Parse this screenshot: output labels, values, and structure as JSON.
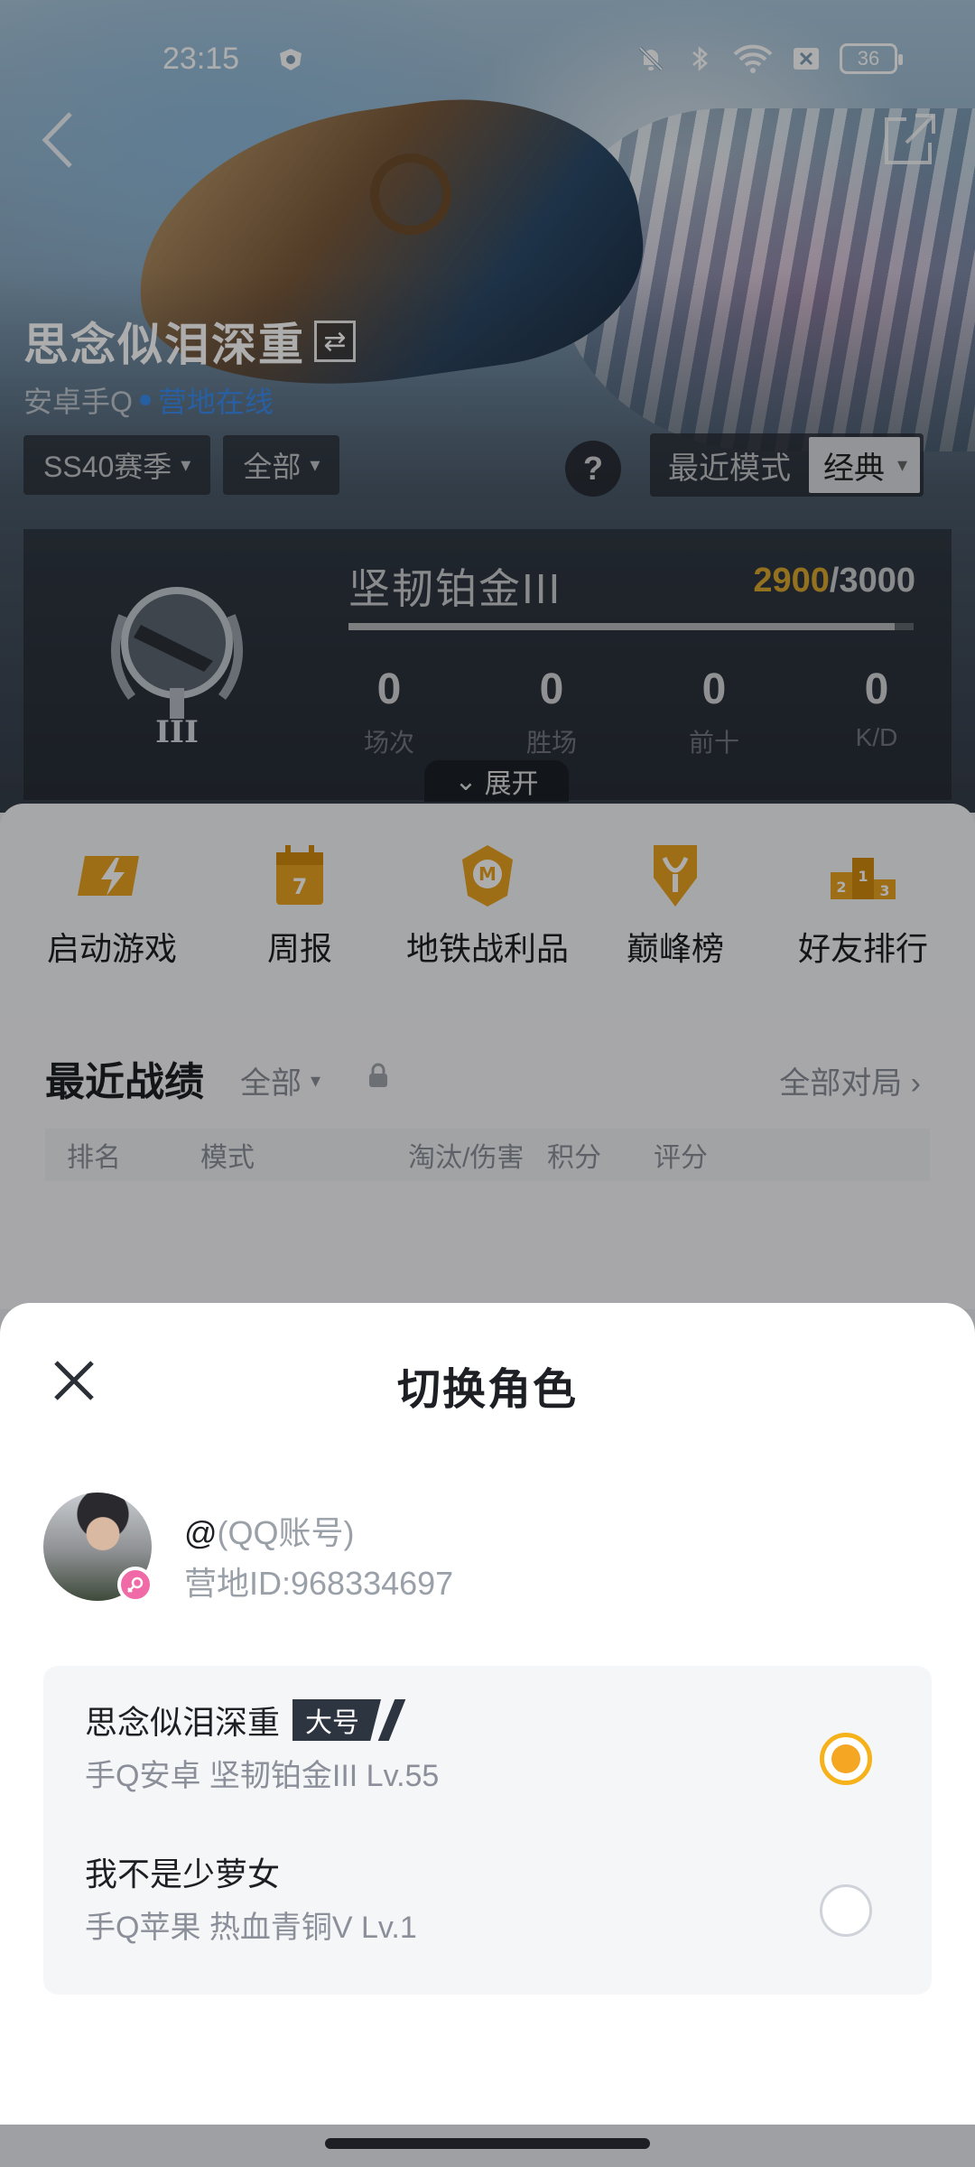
{
  "status_bar": {
    "time": "23:15",
    "battery": "36",
    "icons": [
      "mute-icon",
      "bluetooth-icon",
      "wifi-icon",
      "sim-blocked-icon",
      "battery-icon"
    ]
  },
  "profile": {
    "name": "思念似泪深重",
    "platform": "安卓手Q",
    "online_status": "营地在线"
  },
  "filters": {
    "season": "SS40赛季",
    "scope": "全部",
    "recent_mode_label": "最近模式",
    "mode": "经典",
    "help": "?"
  },
  "rank": {
    "name": "坚韧铂金III",
    "current_points": "2900",
    "max_points": "/3000",
    "progress": 0.967,
    "emblem_tier": "III",
    "stats": [
      {
        "value": "0",
        "label": "场次"
      },
      {
        "value": "0",
        "label": "胜场"
      },
      {
        "value": "0",
        "label": "前十"
      },
      {
        "value": "0",
        "label": "K/D"
      }
    ],
    "expand": "展开"
  },
  "actions": [
    {
      "label": "启动游戏",
      "icon": "lightning-icon"
    },
    {
      "label": "周报",
      "icon": "calendar-icon"
    },
    {
      "label": "地铁战利品",
      "icon": "metro-emblem-icon"
    },
    {
      "label": "巅峰榜",
      "icon": "trophy-icon"
    },
    {
      "label": "好友排行",
      "icon": "podium-icon"
    }
  ],
  "recent": {
    "title": "最近战绩",
    "filter": "全部",
    "all_games": "全部对局",
    "columns": [
      "排名",
      "模式",
      "淘汰/伤害",
      "积分",
      "评分"
    ]
  },
  "sheet": {
    "title": "切换角色",
    "account_prefix": "@",
    "account": "(QQ账号)",
    "camp_id": "营地ID:968334697",
    "roles": [
      {
        "name": "思念似泪深重",
        "badge": "大号",
        "meta": "手Q安卓  坚韧铂金III  Lv.55",
        "selected": true
      },
      {
        "name": "我不是少萝女",
        "badge": "",
        "meta": "手Q苹果  热血青铜V  Lv.1",
        "selected": false
      }
    ]
  },
  "colors": {
    "accent": "#f5a623",
    "points": "#d9a72d",
    "online": "#3b8df0",
    "badge_bg": "#2c3540"
  }
}
